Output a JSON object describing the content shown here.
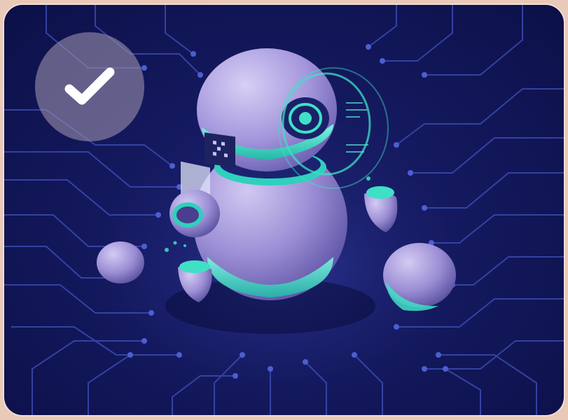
{
  "tile": {
    "illustration": "robot-ai-circuit-illustration",
    "badge_icon": "checkmark-icon",
    "selected": true,
    "colors": {
      "background": "#14195e",
      "circuit": "#3a4bb0",
      "robot_body": "#a79ad8",
      "accent": "#3fe0c6",
      "badge": "#968caa"
    }
  }
}
